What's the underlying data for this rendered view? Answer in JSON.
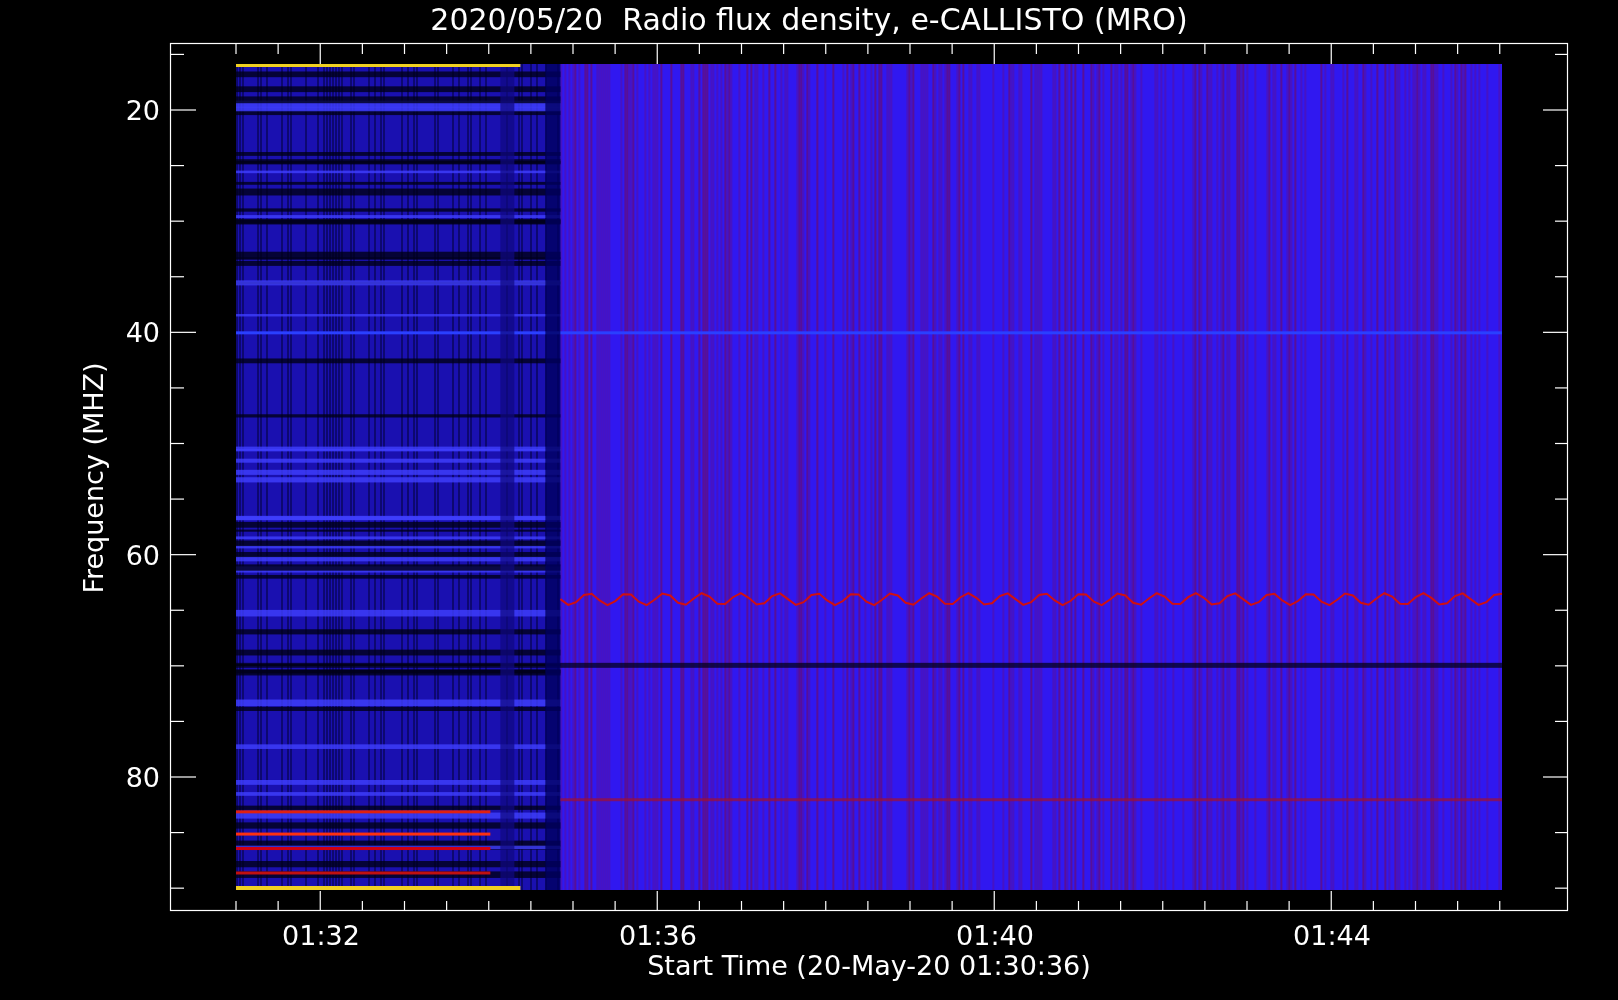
{
  "title": "2020/05/20  Radio flux density, e-CALLISTO (MRO)",
  "y_axis": {
    "label": "Frequency (MHZ)",
    "ticks": [
      "20",
      "40",
      "60",
      "80"
    ]
  },
  "x_axis": {
    "label": "Start Time (20-May-20 01:30:36)",
    "ticks": [
      "01:32",
      "01:36",
      "01:40",
      "01:44"
    ]
  }
}
